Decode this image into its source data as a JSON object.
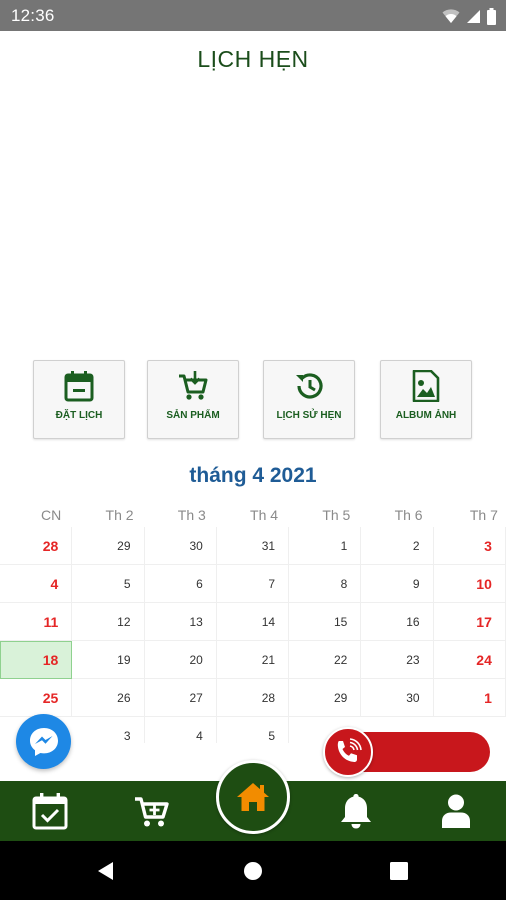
{
  "status_bar": {
    "time": "12:36"
  },
  "header": {
    "title": "LỊCH HẸN"
  },
  "actions": [
    {
      "label": "ĐẶT LỊCH",
      "icon": "calendar-minus-icon"
    },
    {
      "label": "SẢN PHẨM",
      "icon": "cart-icon"
    },
    {
      "label": "LỊCH SỬ HẸN",
      "icon": "history-icon"
    },
    {
      "label": "ALBUM ẢNH",
      "icon": "image-file-icon"
    }
  ],
  "calendar": {
    "month_label": "tháng 4 2021",
    "weekdays": [
      "CN",
      "Th 2",
      "Th 3",
      "Th 4",
      "Th 5",
      "Th 6",
      "Th 7"
    ],
    "weeks": [
      [
        "28",
        "29",
        "30",
        "31",
        "1",
        "2",
        "3"
      ],
      [
        "4",
        "5",
        "6",
        "7",
        "8",
        "9",
        "10"
      ],
      [
        "11",
        "12",
        "13",
        "14",
        "15",
        "16",
        "17"
      ],
      [
        "18",
        "19",
        "20",
        "21",
        "22",
        "23",
        "24"
      ],
      [
        "25",
        "26",
        "27",
        "28",
        "29",
        "30",
        "1"
      ],
      [
        "",
        "3",
        "4",
        "5",
        "",
        "",
        ""
      ]
    ],
    "selected_day": "18"
  },
  "colors": {
    "primary_green": "#1e4d12",
    "title_green": "#1b4d1b",
    "month_blue": "#1f5c96",
    "weekend_red": "#e52626",
    "call_red": "#c8171c",
    "home_icon_orange": "#f28c00",
    "messenger_blue": "#1e88e5"
  },
  "floating": {
    "messenger_icon": "messenger-icon",
    "call_icon": "phone-ringing-icon"
  },
  "bottom_nav": [
    {
      "name": "calendar-check",
      "icon": "calendar-check-icon"
    },
    {
      "name": "add-cart",
      "icon": "cart-plus-icon"
    },
    {
      "name": "home",
      "icon": "home-icon"
    },
    {
      "name": "notifications",
      "icon": "bell-icon"
    },
    {
      "name": "profile",
      "icon": "user-icon"
    }
  ]
}
